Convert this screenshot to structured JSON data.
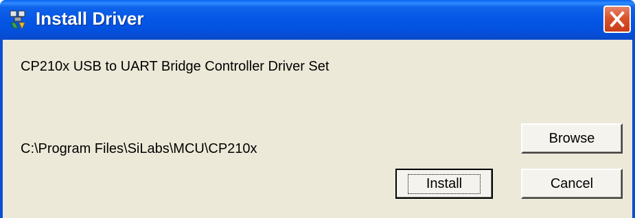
{
  "window": {
    "title": "Install Driver",
    "app_icon": "driver-install-icon",
    "close_icon": "close-icon",
    "colors": {
      "titlebar": "#0556e6",
      "close": "#d9532d",
      "client": "#ece9d8"
    }
  },
  "content": {
    "description": "CP210x USB to UART Bridge Controller Driver Set",
    "install_path": "C:\\Program Files\\SiLabs\\MCU\\CP210x"
  },
  "buttons": {
    "browse": "Browse",
    "install": "Install",
    "cancel": "Cancel"
  }
}
